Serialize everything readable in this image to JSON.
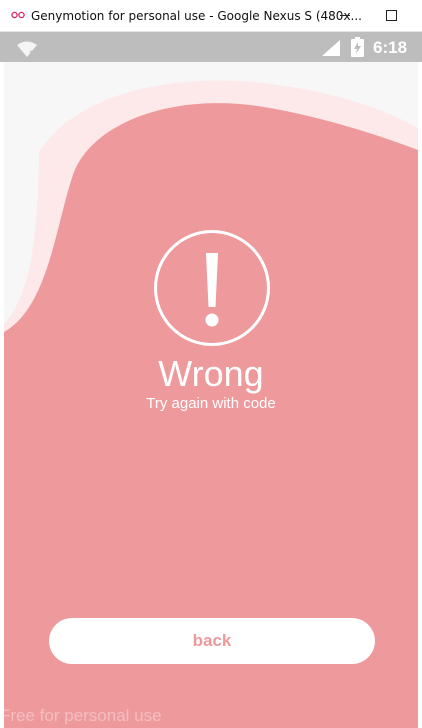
{
  "window": {
    "title": "Genymotion for personal use - Google Nexus S (480x...",
    "icon": "genymotion-logo-icon",
    "controls": [
      "minimize-icon",
      "maximize-icon"
    ]
  },
  "status_bar": {
    "time": "6:18",
    "icons": [
      "wifi-question-icon",
      "signal-icon",
      "battery-charging-icon"
    ]
  },
  "screen": {
    "icon": "exclamation-circle-icon",
    "heading": "Wrong",
    "subheading": "Try again with code",
    "back_button": "back"
  },
  "watermark": "Free for personal use",
  "colors": {
    "primary": "#ee9a9c",
    "secondary": "#fde8ea",
    "background": "#f7f7f7",
    "status_bar": "#bdbdbd",
    "text_on_primary": "#ffffff"
  }
}
